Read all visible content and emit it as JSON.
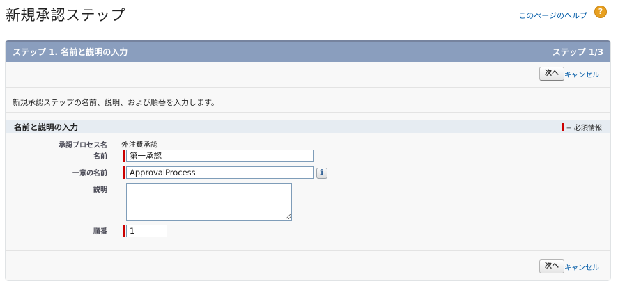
{
  "page": {
    "title": "新規承認ステップ",
    "help_link": "このページのヘルプ",
    "help_icon": "?"
  },
  "panel": {
    "step_title": "ステップ 1. 名前と説明の入力",
    "step_count": "ステップ 1/3",
    "description": "新規承認ステップの名前、説明、および順番を入力します。"
  },
  "buttons": {
    "next": "次へ",
    "cancel": "キャンセル"
  },
  "section": {
    "title": "名前と説明の入力",
    "required_legend": "= 必須情報"
  },
  "form": {
    "process_name_label": "承認プロセス名",
    "process_name_value": "外注費承認",
    "name_label": "名前",
    "name_value": "第一承認",
    "unique_name_label": "一意の名前",
    "unique_name_value": "ApprovalProcess",
    "info_icon": "i",
    "description_label": "説明",
    "description_value": "",
    "order_label": "順番",
    "order_value": "1"
  },
  "colors": {
    "header_bar": "#8a9ebe",
    "section_bar": "#e6ecf2",
    "required": "#cc0000",
    "link": "#015ba7",
    "help_icon": "#e8a020"
  }
}
